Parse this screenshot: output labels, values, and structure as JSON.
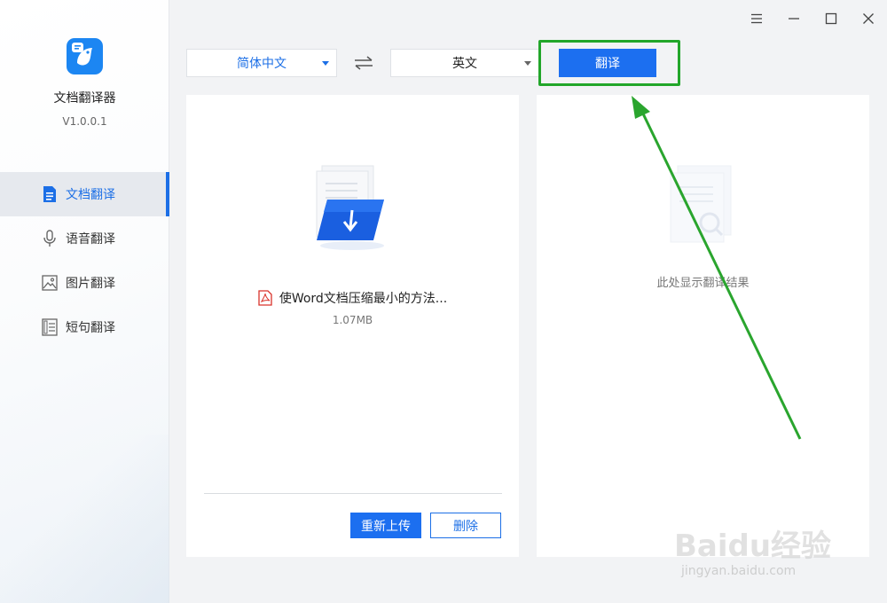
{
  "app": {
    "name": "文档翻译器",
    "version": "V1.0.0.1"
  },
  "sidebar": {
    "items": [
      {
        "label": "文档翻译",
        "icon": "document-icon",
        "active": true
      },
      {
        "label": "语音翻译",
        "icon": "microphone-icon",
        "active": false
      },
      {
        "label": "图片翻译",
        "icon": "image-icon",
        "active": false
      },
      {
        "label": "短句翻译",
        "icon": "text-lines-icon",
        "active": false
      }
    ]
  },
  "window_controls": [
    "menu-icon",
    "minimize-icon",
    "maximize-icon",
    "close-icon"
  ],
  "toolbar": {
    "source_language": "简体中文",
    "target_language": "英文",
    "translate_label": "翻译"
  },
  "upload_panel": {
    "file_name": "使Word文档压缩最小的方法...",
    "file_size": "1.07MB",
    "reupload_label": "重新上传",
    "delete_label": "删除"
  },
  "result_panel": {
    "placeholder": "此处显示翻译结果"
  },
  "watermark": {
    "main": "Baidu经验",
    "sub": "jingyan.baidu.com"
  },
  "colors": {
    "accent": "#1c6ff0",
    "highlight": "#22a62a",
    "pdf": "#d9332b"
  }
}
